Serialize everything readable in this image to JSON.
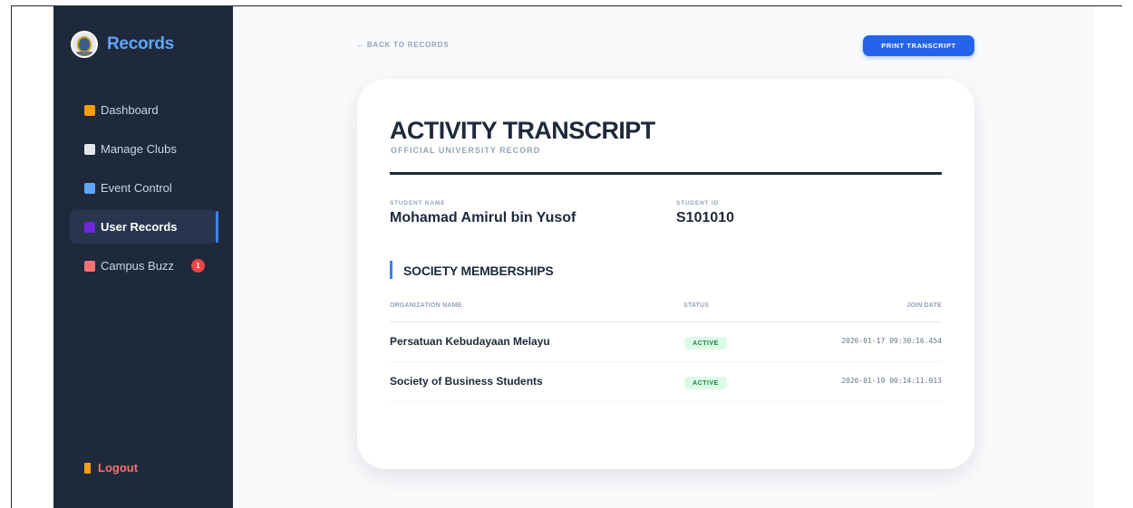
{
  "sidebar": {
    "brand": "Records",
    "items": [
      {
        "label": "Dashboard",
        "icon": "house-icon",
        "color": "#f59e0b"
      },
      {
        "label": "Manage Clubs",
        "icon": "bank-icon",
        "color": "#e5e7eb"
      },
      {
        "label": "Event Control",
        "icon": "calendar-icon",
        "color": "#60a5fa"
      },
      {
        "label": "User Records",
        "icon": "people-icon",
        "color": "#6d28d9",
        "active": true
      },
      {
        "label": "Campus Buzz",
        "icon": "megaphone-icon",
        "color": "#f87171",
        "badge": "1"
      }
    ],
    "logout": "Logout"
  },
  "main": {
    "back_label": "← BACK TO RECORDS",
    "print_label": "PRINT TRANSCRIPT"
  },
  "transcript": {
    "title": "ACTIVITY TRANSCRIPT",
    "subtitle": "OFFICIAL UNIVERSITY RECORD",
    "student_name_label": "STUDENT NAME",
    "student_name": "Mohamad Amirul bin Yusof",
    "student_id_label": "STUDENT ID",
    "student_id": "S101010",
    "section_title": "SOCIETY MEMBERSHIPS",
    "columns": [
      "ORGANIZATION NAME",
      "STATUS",
      "JOIN DATE"
    ],
    "rows": [
      {
        "org": "Persatuan Kebudayaan Melayu",
        "status": "ACTIVE",
        "date": "2026-01-17 09:30:16.454"
      },
      {
        "org": "Society of Business Students",
        "status": "ACTIVE",
        "date": "2026-01-19 00:14:11.913"
      }
    ]
  },
  "colors": {
    "sidebar_bg": "#1e293b",
    "accent": "#2563eb",
    "brand": "#60a5fa",
    "active_badge_bg": "#dcfce7",
    "active_badge_text": "#15803d",
    "logout": "#f87171",
    "notification": "#ef4444"
  }
}
